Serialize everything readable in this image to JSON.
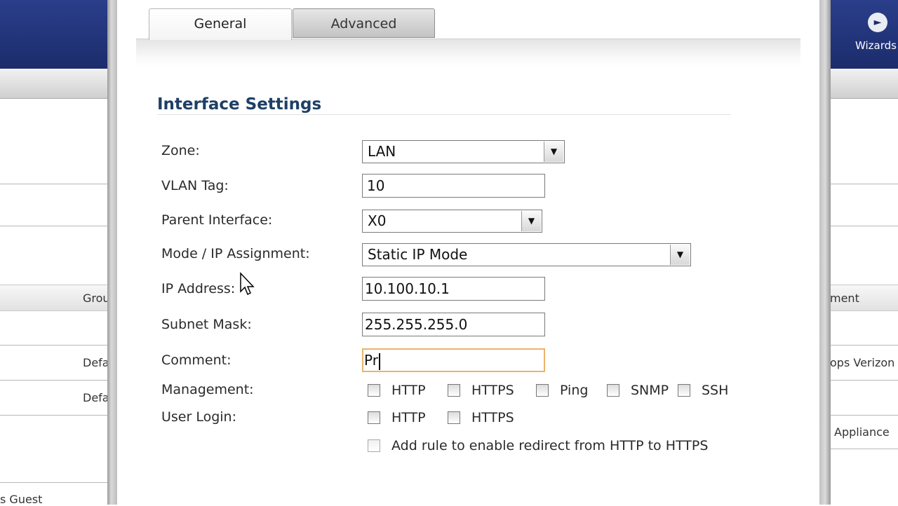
{
  "background_app": {
    "left_texts": [
      "Grou",
      "Defa",
      "Defa",
      "s Guest"
    ],
    "right_texts": [
      "ment",
      "ops Verizon I",
      "Appliance"
    ],
    "wizards_label": "Wizards"
  },
  "tabs": [
    {
      "label": "General",
      "active": true
    },
    {
      "label": "Advanced",
      "active": false
    }
  ],
  "section_title": "Interface Settings",
  "fields": {
    "zone": {
      "label": "Zone:",
      "value": "LAN"
    },
    "vlan_tag": {
      "label": "VLAN Tag:",
      "value": "10"
    },
    "parent_interface": {
      "label": "Parent Interface:",
      "value": "X0"
    },
    "mode": {
      "label": "Mode / IP Assignment:",
      "value": "Static IP Mode"
    },
    "ip_address": {
      "label": "IP Address:",
      "value": "10.100.10.1"
    },
    "subnet_mask": {
      "label": "Subnet Mask:",
      "value": "255.255.255.0"
    },
    "comment": {
      "label": "Comment:",
      "value": "Pr"
    }
  },
  "management": {
    "label": "Management:",
    "options": [
      "HTTP",
      "HTTPS",
      "Ping",
      "SNMP",
      "SSH"
    ]
  },
  "user_login": {
    "label": "User Login:",
    "options": [
      "HTTP",
      "HTTPS"
    ]
  },
  "redirect_option": "Add rule to enable redirect from HTTP to HTTPS",
  "colors": {
    "navy": "#1c2c6c",
    "section_title": "#1e3f66",
    "focus_border": "#e8b46a"
  }
}
